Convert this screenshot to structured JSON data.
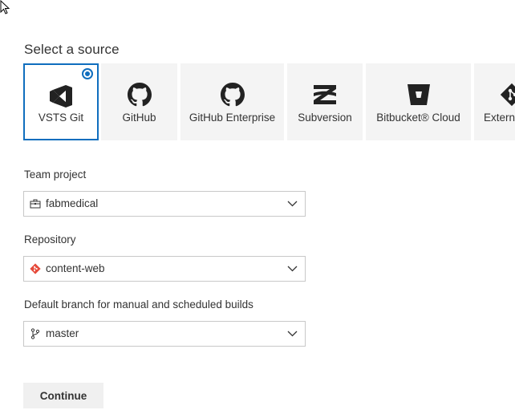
{
  "heading": "Select a source",
  "sources": [
    {
      "label": "VSTS Git",
      "icon": "vsts-git-icon",
      "selected": true
    },
    {
      "label": "GitHub",
      "icon": "github-icon",
      "selected": false
    },
    {
      "label": "GitHub Enterprise",
      "icon": "github-enterprise-icon",
      "selected": false
    },
    {
      "label": "Subversion",
      "icon": "subversion-icon",
      "selected": false
    },
    {
      "label": "Bitbucket® Cloud",
      "icon": "bitbucket-icon",
      "selected": false
    },
    {
      "label": "External Git",
      "icon": "external-git-icon",
      "selected": false
    }
  ],
  "fields": {
    "team_project": {
      "label": "Team project",
      "value": "fabmedical",
      "icon": "project-icon"
    },
    "repository": {
      "label": "Repository",
      "value": "content-web",
      "icon": "git-repo-icon"
    },
    "branch": {
      "label": "Default branch for manual and scheduled builds",
      "value": "master",
      "icon": "branch-icon"
    }
  },
  "continue_label": "Continue",
  "colors": {
    "accent": "#106ebe",
    "tile_bg": "#f4f4f4",
    "git_orange": "#e64a3b",
    "button_bg": "#f0f0f0"
  }
}
